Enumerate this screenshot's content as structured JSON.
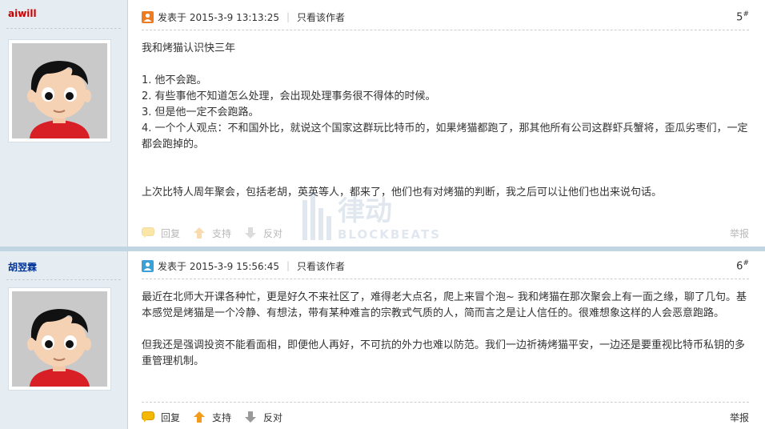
{
  "posts": [
    {
      "author": "aiwill",
      "meta_prefix": "发表于 2015-3-9 13:13:25",
      "only_author": "只看该作者",
      "floor_num": "5",
      "floor_sup": "#",
      "paragraphs": [
        "我和烤猫认识快三年",
        "",
        "1. 他不会跑。",
        "2. 有些事他不知道怎么处理，会出现处理事务很不得体的时候。",
        "3. 但是他一定不会跑路。",
        "4. 一个个人观点：不和国外比，就说这个国家这群玩比特币的，如果烤猫都跑了，那其他所有公司这群虾兵蟹将，歪瓜劣枣们，一定都会跑掉的。",
        "",
        "",
        "上次比特人周年聚会，包括老胡，英英等人，都来了，他们也有对烤猫的判断，我之后可以让他们也出来说句话。"
      ],
      "actions": {
        "reply": "回复",
        "support": "支持",
        "oppose": "反对",
        "report": "举报"
      }
    },
    {
      "author": "胡翌霖",
      "meta_prefix": "发表于 2015-3-9 15:56:45",
      "only_author": "只看该作者",
      "floor_num": "6",
      "floor_sup": "#",
      "paragraphs": [
        "最近在北师大开课各种忙，更是好久不来社区了，难得老大点名，爬上来冒个泡~ 我和烤猫在那次聚会上有一面之缘，聊了几句。基本感觉是烤猫是一个冷静、有想法，带有某种难言的宗教式气质的人，简而言之是让人信任的。很难想象这样的人会恶意跑路。",
        "",
        "但我还是强调投资不能看面相，即便他人再好，不可抗的外力也难以防范。我们一边祈祷烤猫平安，一边还是要重视比特币私钥的多重管理机制。"
      ],
      "actions": {
        "reply": "回复",
        "support": "支持",
        "oppose": "反对",
        "report": "举报"
      }
    }
  ],
  "watermark": {
    "main": "律动",
    "sub": "BLOCKBEATS"
  },
  "colors": {
    "sidebar_bg": "#e5edf2",
    "border": "#c2d5e3",
    "link": "#003399",
    "author_red": "#cc0000"
  },
  "icons": [
    "user-online-icon",
    "user-offline-icon",
    "reply-bubble-icon",
    "support-arrow-icon",
    "oppose-arrow-icon",
    "avatar-image"
  ]
}
